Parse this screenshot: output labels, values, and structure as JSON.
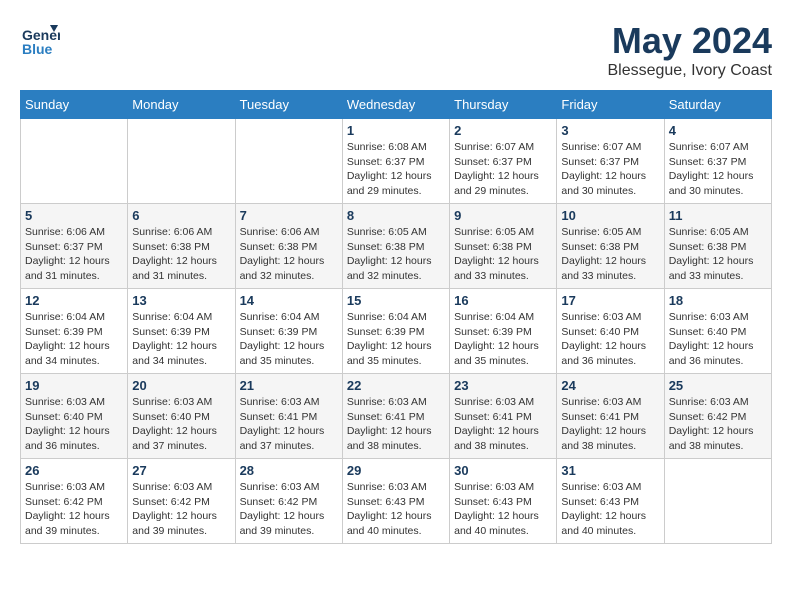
{
  "header": {
    "logo_line1": "General",
    "logo_line2": "Blue",
    "month": "May 2024",
    "location": "Blessegue, Ivory Coast"
  },
  "weekdays": [
    "Sunday",
    "Monday",
    "Tuesday",
    "Wednesday",
    "Thursday",
    "Friday",
    "Saturday"
  ],
  "weeks": [
    [
      {
        "day": "",
        "info": ""
      },
      {
        "day": "",
        "info": ""
      },
      {
        "day": "",
        "info": ""
      },
      {
        "day": "1",
        "info": "Sunrise: 6:08 AM\nSunset: 6:37 PM\nDaylight: 12 hours\nand 29 minutes."
      },
      {
        "day": "2",
        "info": "Sunrise: 6:07 AM\nSunset: 6:37 PM\nDaylight: 12 hours\nand 29 minutes."
      },
      {
        "day": "3",
        "info": "Sunrise: 6:07 AM\nSunset: 6:37 PM\nDaylight: 12 hours\nand 30 minutes."
      },
      {
        "day": "4",
        "info": "Sunrise: 6:07 AM\nSunset: 6:37 PM\nDaylight: 12 hours\nand 30 minutes."
      }
    ],
    [
      {
        "day": "5",
        "info": "Sunrise: 6:06 AM\nSunset: 6:37 PM\nDaylight: 12 hours\nand 31 minutes."
      },
      {
        "day": "6",
        "info": "Sunrise: 6:06 AM\nSunset: 6:38 PM\nDaylight: 12 hours\nand 31 minutes."
      },
      {
        "day": "7",
        "info": "Sunrise: 6:06 AM\nSunset: 6:38 PM\nDaylight: 12 hours\nand 32 minutes."
      },
      {
        "day": "8",
        "info": "Sunrise: 6:05 AM\nSunset: 6:38 PM\nDaylight: 12 hours\nand 32 minutes."
      },
      {
        "day": "9",
        "info": "Sunrise: 6:05 AM\nSunset: 6:38 PM\nDaylight: 12 hours\nand 33 minutes."
      },
      {
        "day": "10",
        "info": "Sunrise: 6:05 AM\nSunset: 6:38 PM\nDaylight: 12 hours\nand 33 minutes."
      },
      {
        "day": "11",
        "info": "Sunrise: 6:05 AM\nSunset: 6:38 PM\nDaylight: 12 hours\nand 33 minutes."
      }
    ],
    [
      {
        "day": "12",
        "info": "Sunrise: 6:04 AM\nSunset: 6:39 PM\nDaylight: 12 hours\nand 34 minutes."
      },
      {
        "day": "13",
        "info": "Sunrise: 6:04 AM\nSunset: 6:39 PM\nDaylight: 12 hours\nand 34 minutes."
      },
      {
        "day": "14",
        "info": "Sunrise: 6:04 AM\nSunset: 6:39 PM\nDaylight: 12 hours\nand 35 minutes."
      },
      {
        "day": "15",
        "info": "Sunrise: 6:04 AM\nSunset: 6:39 PM\nDaylight: 12 hours\nand 35 minutes."
      },
      {
        "day": "16",
        "info": "Sunrise: 6:04 AM\nSunset: 6:39 PM\nDaylight: 12 hours\nand 35 minutes."
      },
      {
        "day": "17",
        "info": "Sunrise: 6:03 AM\nSunset: 6:40 PM\nDaylight: 12 hours\nand 36 minutes."
      },
      {
        "day": "18",
        "info": "Sunrise: 6:03 AM\nSunset: 6:40 PM\nDaylight: 12 hours\nand 36 minutes."
      }
    ],
    [
      {
        "day": "19",
        "info": "Sunrise: 6:03 AM\nSunset: 6:40 PM\nDaylight: 12 hours\nand 36 minutes."
      },
      {
        "day": "20",
        "info": "Sunrise: 6:03 AM\nSunset: 6:40 PM\nDaylight: 12 hours\nand 37 minutes."
      },
      {
        "day": "21",
        "info": "Sunrise: 6:03 AM\nSunset: 6:41 PM\nDaylight: 12 hours\nand 37 minutes."
      },
      {
        "day": "22",
        "info": "Sunrise: 6:03 AM\nSunset: 6:41 PM\nDaylight: 12 hours\nand 38 minutes."
      },
      {
        "day": "23",
        "info": "Sunrise: 6:03 AM\nSunset: 6:41 PM\nDaylight: 12 hours\nand 38 minutes."
      },
      {
        "day": "24",
        "info": "Sunrise: 6:03 AM\nSunset: 6:41 PM\nDaylight: 12 hours\nand 38 minutes."
      },
      {
        "day": "25",
        "info": "Sunrise: 6:03 AM\nSunset: 6:42 PM\nDaylight: 12 hours\nand 38 minutes."
      }
    ],
    [
      {
        "day": "26",
        "info": "Sunrise: 6:03 AM\nSunset: 6:42 PM\nDaylight: 12 hours\nand 39 minutes."
      },
      {
        "day": "27",
        "info": "Sunrise: 6:03 AM\nSunset: 6:42 PM\nDaylight: 12 hours\nand 39 minutes."
      },
      {
        "day": "28",
        "info": "Sunrise: 6:03 AM\nSunset: 6:42 PM\nDaylight: 12 hours\nand 39 minutes."
      },
      {
        "day": "29",
        "info": "Sunrise: 6:03 AM\nSunset: 6:43 PM\nDaylight: 12 hours\nand 40 minutes."
      },
      {
        "day": "30",
        "info": "Sunrise: 6:03 AM\nSunset: 6:43 PM\nDaylight: 12 hours\nand 40 minutes."
      },
      {
        "day": "31",
        "info": "Sunrise: 6:03 AM\nSunset: 6:43 PM\nDaylight: 12 hours\nand 40 minutes."
      },
      {
        "day": "",
        "info": ""
      }
    ]
  ]
}
